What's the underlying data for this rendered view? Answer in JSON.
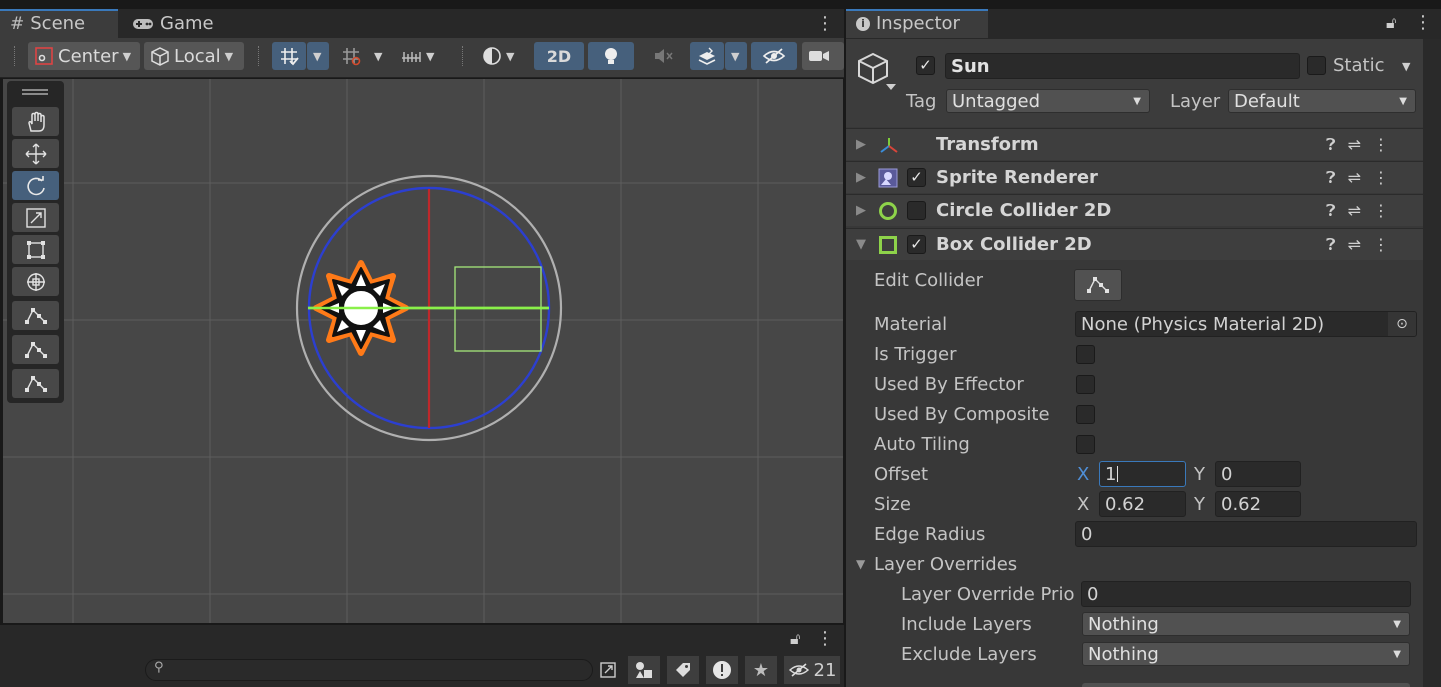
{
  "scene_window": {
    "tabs": [
      {
        "label": "Scene",
        "icon": "hash-icon"
      },
      {
        "label": "Game",
        "icon": "gamepad-icon"
      }
    ],
    "toolbar": {
      "pivot_mode": "Center",
      "pivot_rotation": "Local",
      "mode_2d": "2D"
    },
    "tools": [
      "hand-tool",
      "move-tool",
      "rotate-tool",
      "scale-tool",
      "rect-tool",
      "transform-tool",
      "edit-collider-tool",
      "edit-collider-tool",
      "edit-collider-tool"
    ],
    "selected_tool": "rotate-tool",
    "colors": {
      "viewport_bg": "#474747",
      "grid_line": "#5e5e5e",
      "circle_collider": "#2c3fd0",
      "x_axis": "#8af04a",
      "y_axis": "#c0282b",
      "box_collider": "#a6e87a"
    }
  },
  "project_bar": {
    "hidden_count": "21"
  },
  "inspector": {
    "tab_label": "Inspector",
    "object": {
      "name": "Sun",
      "active": true,
      "static_label": "Static",
      "tag_label": "Tag",
      "tag_value": "Untagged",
      "layer_label": "Layer",
      "layer_value": "Default"
    },
    "components": [
      {
        "name": "Transform",
        "has_checkbox": false,
        "expanded": false
      },
      {
        "name": "Sprite Renderer",
        "has_checkbox": true,
        "enabled": true,
        "expanded": false
      },
      {
        "name": "Circle Collider 2D",
        "has_checkbox": true,
        "enabled": false,
        "expanded": false
      },
      {
        "name": "Box Collider 2D",
        "has_checkbox": true,
        "enabled": true,
        "expanded": true
      }
    ],
    "box_collider": {
      "edit_collider_label": "Edit Collider",
      "material_label": "Material",
      "material_value": "None (Physics Material 2D)",
      "is_trigger_label": "Is Trigger",
      "used_by_effector_label": "Used By Effector",
      "used_by_composite_label": "Used By Composite",
      "auto_tiling_label": "Auto Tiling",
      "offset_label": "Offset",
      "offset_x": "1",
      "offset_y": "0",
      "size_label": "Size",
      "size_x": "0.62",
      "size_y": "0.62",
      "x_axis_label": "X",
      "y_axis_label": "Y",
      "edge_radius_label": "Edge Radius",
      "edge_radius_value": "0",
      "layer_overrides_label": "Layer Overrides",
      "layer_override_priority_label": "Layer Override Prior",
      "layer_override_priority_value": "0",
      "include_layers_label": "Include Layers",
      "include_layers_value": "Nothing",
      "exclude_layers_label": "Exclude Layers",
      "exclude_layers_value": "Nothing"
    }
  }
}
